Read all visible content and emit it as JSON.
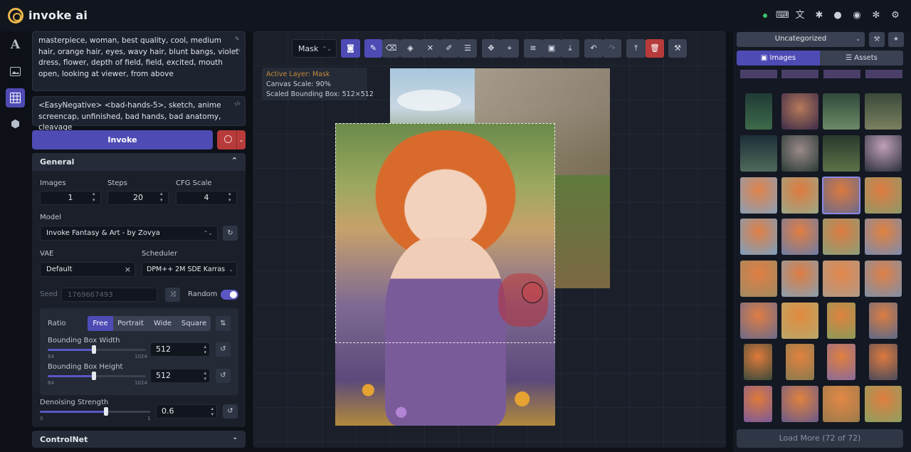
{
  "header": {
    "brand": "invoke ai",
    "icons": [
      "keyboard-icon",
      "translate-icon",
      "bug-icon",
      "github-icon",
      "discord-icon",
      "cog-icon",
      "settings-icon"
    ]
  },
  "left_rail": [
    "text-icon",
    "image-icon",
    "grid-icon",
    "cube-icon"
  ],
  "prompts": {
    "positive": "masterpiece, woman, best quality, cool, medium hair, orange hair, eyes, wavy hair, blunt bangs, violet dress, flower, depth of field, field, excited, mouth open, looking at viewer, from above",
    "negative": "<EasyNegative> <bad-hands-5>, sketch, anime screencap, unfinished, bad hands, bad anatomy, cleavage"
  },
  "invoke_label": "Invoke",
  "general": {
    "title": "General",
    "images_label": "Images",
    "images_value": "1",
    "steps_label": "Steps",
    "steps_value": "20",
    "cfg_label": "CFG Scale",
    "cfg_value": "4",
    "model_label": "Model",
    "model_value": "Invoke Fantasy & Art - by Zovya",
    "vae_label": "VAE",
    "vae_value": "Default",
    "scheduler_label": "Scheduler",
    "scheduler_value": "DPM++ 2M SDE Karras",
    "seed_label": "Seed",
    "seed_value": "1769667493",
    "random_label": "Random",
    "ratio_label": "Ratio",
    "ratio_options": [
      "Free",
      "Portrait",
      "Wide",
      "Square"
    ],
    "bbw_label": "Bounding Box Width",
    "bbw_value": "512",
    "bbw_min": "64",
    "bbw_max": "1024",
    "bbw_fraction": 0.48,
    "bbh_label": "Bounding Box Height",
    "bbh_value": "512",
    "bbh_min": "64",
    "bbh_max": "1024",
    "bbh_fraction": 0.48,
    "denoise_label": "Denoising Strength",
    "denoise_value": "0.6",
    "denoise_min": "0",
    "denoise_max": "1",
    "denoise_fraction": 0.6
  },
  "controlnet_label": "ControlNet",
  "canvas": {
    "mode": "Mask",
    "active_layer": "Active Layer: Mask",
    "canvas_scale": "Canvas Scale: 90%",
    "scaled_bbox": "Scaled Bounding Box: 512×512"
  },
  "gallery": {
    "board": "Uncategorized",
    "tab_images": "Images",
    "tab_assets": "Assets",
    "load_more": "Load More (72 of 72)"
  },
  "colors": {
    "accent": "#4e4bb5",
    "danger": "#b73b3b",
    "background": "#0d1117",
    "panel": "#1a1f29"
  }
}
